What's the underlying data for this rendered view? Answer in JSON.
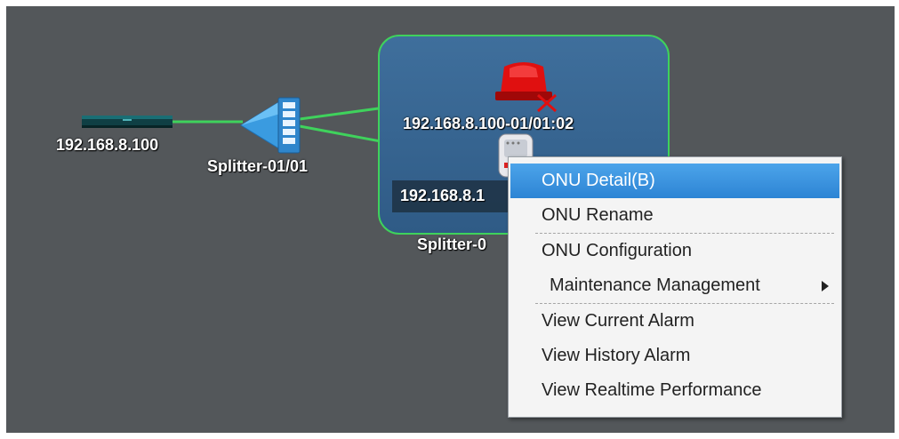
{
  "topology": {
    "olt_label": "192.168.8.100",
    "splitter_label": "Splitter-01/01",
    "group_label": "Splitter-0",
    "onu_label_1": "192.168.8.100-01/01:02",
    "onu_label_2": "192.168.8.1"
  },
  "colors": {
    "canvas": "#53575a",
    "link": "#3fd25c",
    "group_border": "#3fd25c",
    "group_fill": "#3f6f9c",
    "alarm": "#e01010",
    "menu_highlight": "#2d84d4"
  },
  "icons": {
    "olt": "olt-device-icon",
    "splitter": "splitter-icon",
    "alarm": "alarm-siren-icon",
    "onu": "onu-device-icon",
    "submenu": "chevron-right-icon"
  },
  "context_menu": {
    "items": [
      {
        "label": "ONU Detail(B)",
        "highlighted": true
      },
      {
        "label": "ONU Rename"
      },
      {
        "label": "ONU Configuration"
      },
      {
        "label": "Maintenance Management",
        "has_submenu": true
      },
      {
        "label": "View Current Alarm"
      },
      {
        "label": "View History Alarm"
      },
      {
        "label": "View Realtime Performance"
      }
    ]
  }
}
